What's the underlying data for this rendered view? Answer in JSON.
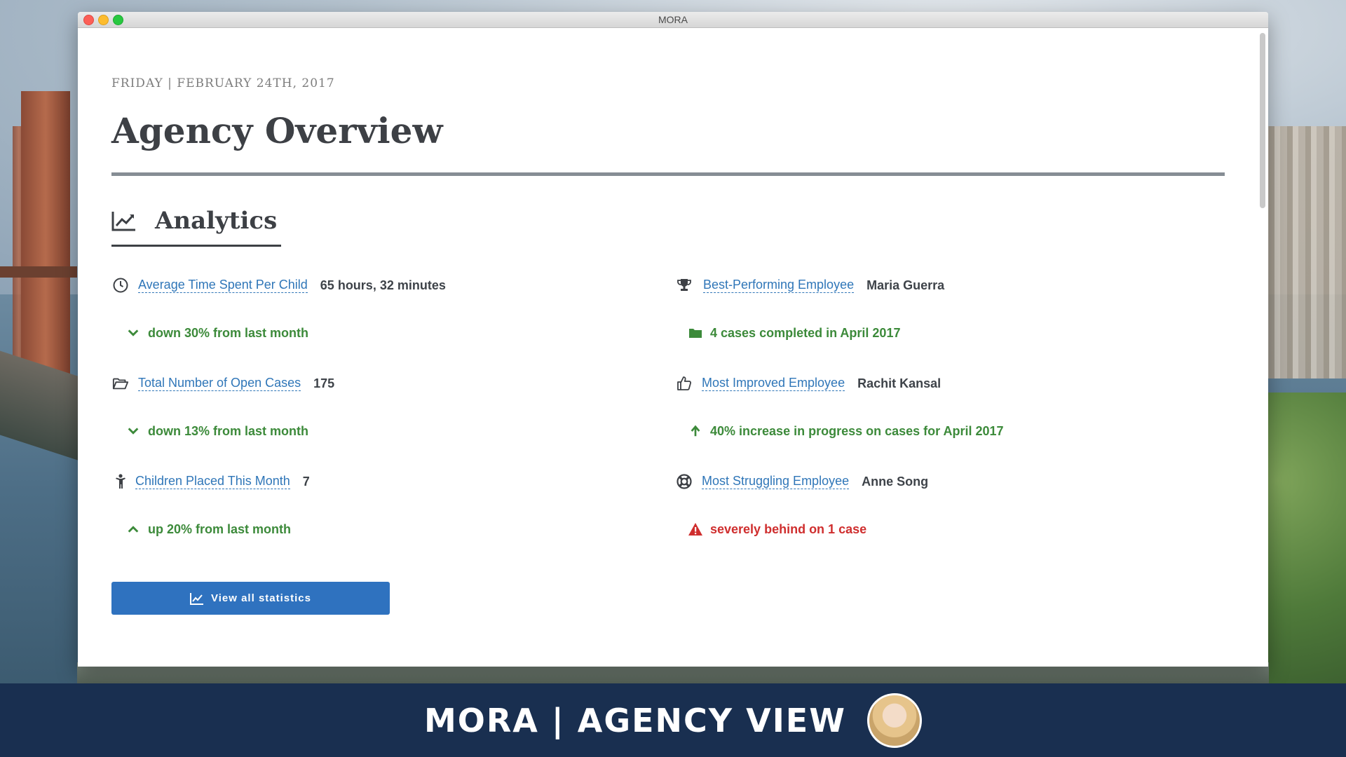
{
  "window": {
    "title": "MORA"
  },
  "header": {
    "date": "FRIDAY | FEBRUARY 24TH, 2017",
    "title": "Agency Overview"
  },
  "analytics": {
    "section_title": "Analytics",
    "left": [
      {
        "icon": "clock-icon",
        "label": "Average Time Spent Per Child",
        "value": "65 hours, 32 minutes",
        "note": "down 30% from last month",
        "note_icon": "chevron-down-icon"
      },
      {
        "icon": "folder-open-icon",
        "label": "Total Number of Open Cases",
        "value": "175",
        "note": "down 13% from last month",
        "note_icon": "chevron-down-icon"
      },
      {
        "icon": "child-icon",
        "label": "Children Placed This Month",
        "value": "7",
        "note": "up 20% from last month",
        "note_icon": "chevron-up-icon"
      }
    ],
    "right": [
      {
        "icon": "trophy-icon",
        "label": "Best-Performing Employee",
        "value": "Maria Guerra",
        "note": "4 cases completed in April 2017",
        "note_icon": "folder-icon"
      },
      {
        "icon": "thumbs-up-icon",
        "label": "Most Improved Employee",
        "value": "Rachit Kansal",
        "note": "40% increase in progress on cases for April 2017",
        "note_icon": "arrow-up-icon"
      },
      {
        "icon": "life-ring-icon",
        "label": "Most Struggling Employee",
        "value": "Anne Song",
        "note": "severely behind on 1 case",
        "note_icon": "warning-icon"
      }
    ],
    "button_label": "View all statistics"
  },
  "banner": {
    "title": "MORA | AGENCY VIEW"
  },
  "colors": {
    "link": "#2f76b8",
    "positive": "#3c8a3a",
    "warning": "#cf2e2e",
    "button": "#2f72bf",
    "banner": "#192f50"
  }
}
